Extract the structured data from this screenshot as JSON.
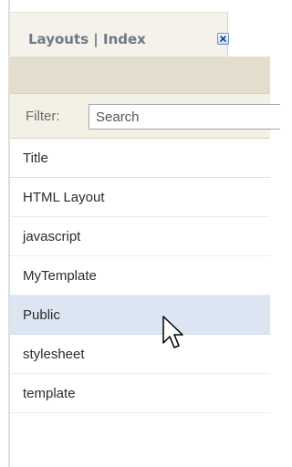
{
  "tab": {
    "title": "Layouts | Index",
    "close_icon": "close-icon"
  },
  "filter": {
    "label": "Filter:",
    "placeholder": "Search"
  },
  "grid": {
    "header": "Title",
    "rows": [
      "HTML Layout",
      "javascript",
      "MyTemplate",
      "Public",
      "stylesheet",
      "template"
    ],
    "selected": "Public"
  },
  "colors": {
    "selected_row": "#dce6f2",
    "toolbar": "#e2ddcd",
    "tab_text": "#6d7a86"
  }
}
